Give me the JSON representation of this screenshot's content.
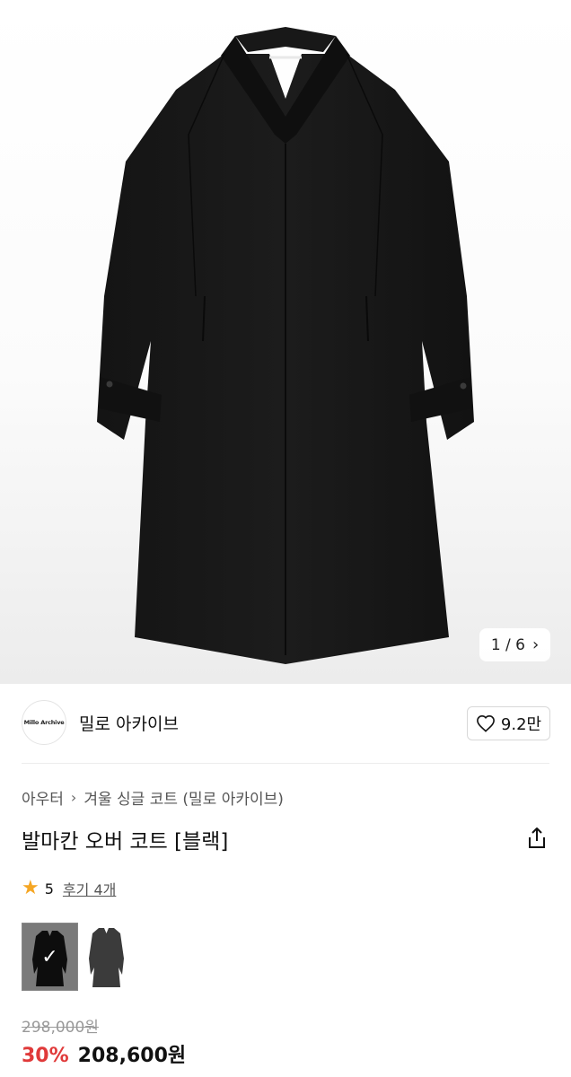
{
  "gallery": {
    "counter_current": "1 / 6",
    "chevron": "›"
  },
  "brand": {
    "logo_text": "Millo Archive",
    "name": "밀로 아카이브"
  },
  "like": {
    "count": "9.2만"
  },
  "breadcrumb": {
    "level1": "아우터",
    "separator": "›",
    "level2": "겨울 싱글 코트 (밀로 아카이브)"
  },
  "product": {
    "title": "발마칸 오버 코트 [블랙]"
  },
  "rating": {
    "score": "5",
    "reviews": "후기 4개",
    "star": "★"
  },
  "colors": {
    "accent_discount": "#e03a3a",
    "star": "#f5a623",
    "text": "#111111",
    "muted": "#999999"
  },
  "price": {
    "original": "298,000원",
    "discount": "30%",
    "sale": "208,600원"
  }
}
